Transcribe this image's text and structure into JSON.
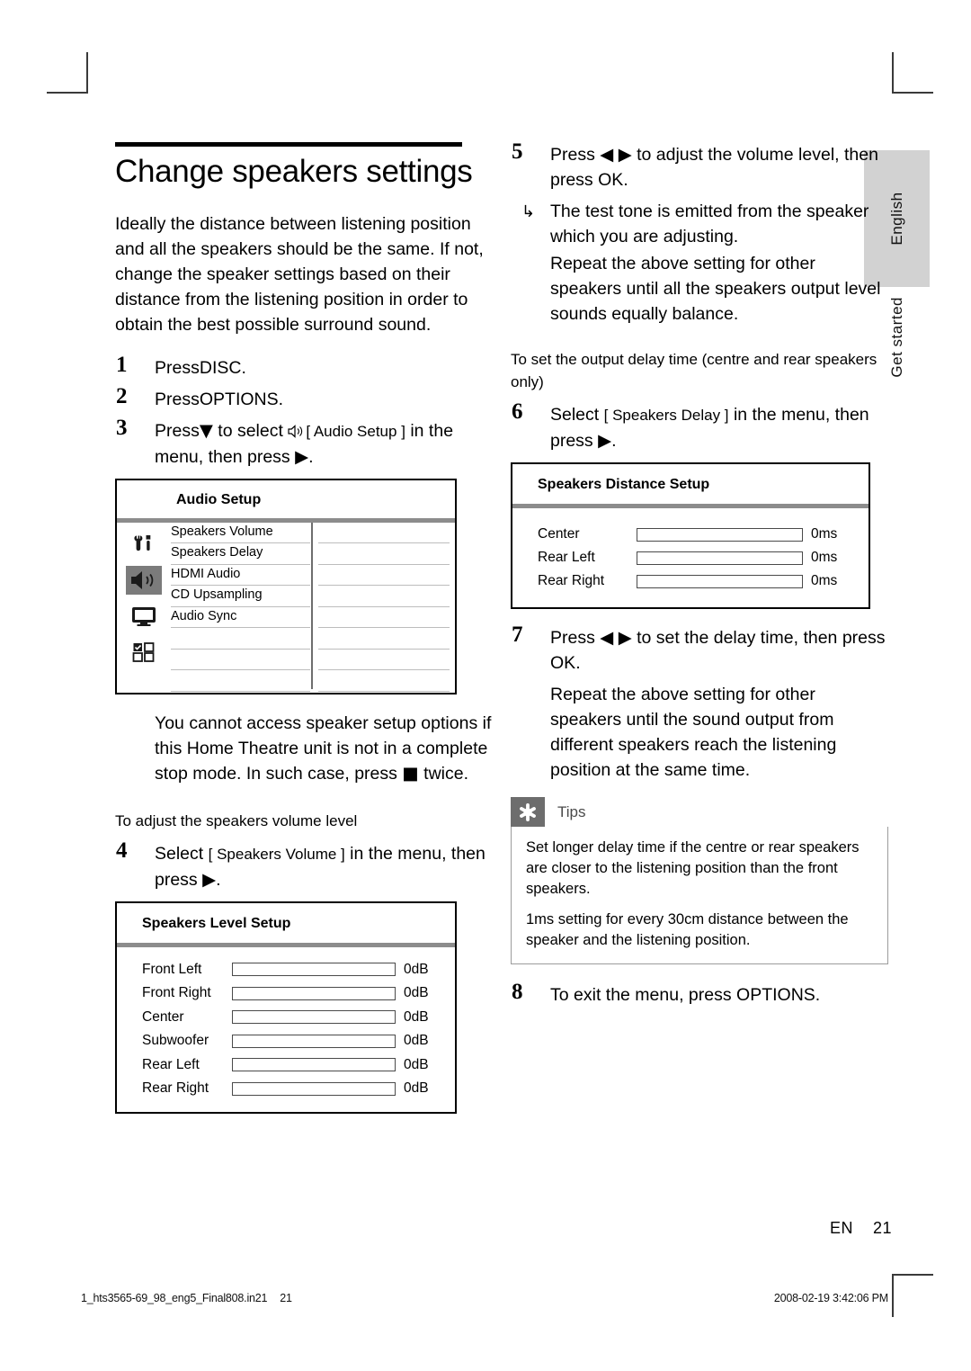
{
  "document": {
    "title": "Change speakers settings",
    "intro": "Ideally the distance between listening position and all the speakers should be the same.  If not, change the speaker settings based on their distance from the listening position in order to obtain the best possible surround sound.",
    "page_number": "21",
    "language_code": "EN",
    "side_tab_language": "English",
    "side_tab_chapter": "Get started"
  },
  "steps": {
    "s1": {
      "num": "1",
      "text_before": "Press",
      "glyph": "",
      "bold": "DISC",
      "text_after": "."
    },
    "s2": {
      "num": "2",
      "text_before": "Press",
      "bold": "OPTIONS",
      "text_after": "."
    },
    "s3": {
      "num": "3",
      "part1": "Press",
      "glyph_down": "▼",
      "part2": " to select ",
      "glyph_speaker": "speaker-icon",
      "bracket": "[ Audio Setup ]",
      "part3": " in the menu, then press ",
      "glyph_right": "▶",
      "part4": "."
    },
    "s4": {
      "num": "4",
      "part1": "Select ",
      "bracket": "[ Speakers Volume ]",
      "part2": " in the menu, then press ",
      "glyph_right": "▶",
      "part3": "."
    },
    "s5": {
      "num": "5",
      "part1": "Press ",
      "glyph_left": "◀",
      "glyph_right": "▶",
      "part2": " to adjust the volume level, then press ",
      "bold": "OK",
      "part3": ".",
      "result_arrow": "↳",
      "result": "The test tone is emitted from the speaker which you are adjusting.",
      "continuation": "Repeat the above setting for other speakers until all the speakers output level sounds equally balance."
    },
    "s6": {
      "num": "6",
      "part1": "Select ",
      "bracket": "[ Speakers Delay ]",
      "part2": " in the menu, then press ",
      "glyph_right": "▶",
      "part3": "."
    },
    "s7": {
      "num": "7",
      "part1": "Press ",
      "glyph_left": "◀",
      "glyph_right": "▶",
      "part2": " to set the delay time, then press ",
      "bold": "OK",
      "part3": ".",
      "continuation": "Repeat the above setting for other speakers until the sound output from different speakers reach the listening position at the same time."
    },
    "s8": {
      "num": "8",
      "part1": "To exit the menu, press ",
      "bold": "OPTIONS",
      "part2": "."
    }
  },
  "notes": {
    "caution": "You cannot access speaker setup options if this Home Theatre unit is not in a complete stop mode.  In such case, press ■ twice.",
    "caution_p1": "You cannot access speaker setup options if this Home Theatre unit is not in a complete stop mode.  In such case, press ",
    "caution_glyph": "■",
    "caution_p2": " twice.",
    "volume_heading": "To adjust the speakers volume level",
    "delay_heading": "To set the output delay time (centre and rear speakers only)"
  },
  "audio_setup_menu": {
    "title": "Audio Setup",
    "icons": [
      "tools-icon",
      "speaker-icon",
      "display-icon",
      "preferences-icon"
    ],
    "selected_icon": "speaker-icon",
    "items": [
      "Speakers Volume",
      "Speakers Delay",
      "HDMI Audio",
      "CD Upsampling",
      "Audio Sync",
      "",
      "",
      ""
    ],
    "values": [
      "",
      "",
      "",
      "",
      "",
      "",
      "",
      ""
    ]
  },
  "speakers_level_setup": {
    "title": "Speakers Level Setup",
    "rows": [
      {
        "name": "Front Left",
        "value": "0dB"
      },
      {
        "name": "Front Right",
        "value": "0dB"
      },
      {
        "name": "Center",
        "value": "0dB"
      },
      {
        "name": "Subwoofer",
        "value": "0dB"
      },
      {
        "name": "Rear Left",
        "value": "0dB"
      },
      {
        "name": "Rear Right",
        "value": "0dB"
      }
    ]
  },
  "speakers_distance_setup": {
    "title": "Speakers Distance Setup",
    "rows": [
      {
        "name": "Center",
        "value": "0ms"
      },
      {
        "name": "Rear Left",
        "value": "0ms"
      },
      {
        "name": "Rear Right",
        "value": "0ms"
      }
    ]
  },
  "tips": {
    "label": "Tips",
    "icon": "asterisk-icon",
    "paragraphs": [
      "Set longer delay time if the centre or rear speakers are closer to the listening position than the front speakers.",
      "1ms setting for every 30cm distance between the speaker and the listening position."
    ]
  },
  "footer": {
    "filename": "1_hts3565-69_98_eng5_Final808.in21",
    "folio": "21",
    "timestamp": "2008-02-19   3:42:06 PM"
  },
  "colors": {
    "tab_grey": "#d2d2d2",
    "osd_separator": "#8c8c8c",
    "icon_selected": "#7b7b7b",
    "tips_icon_bg": "#6d6d6d",
    "tips_border": "#9c9c9c"
  }
}
